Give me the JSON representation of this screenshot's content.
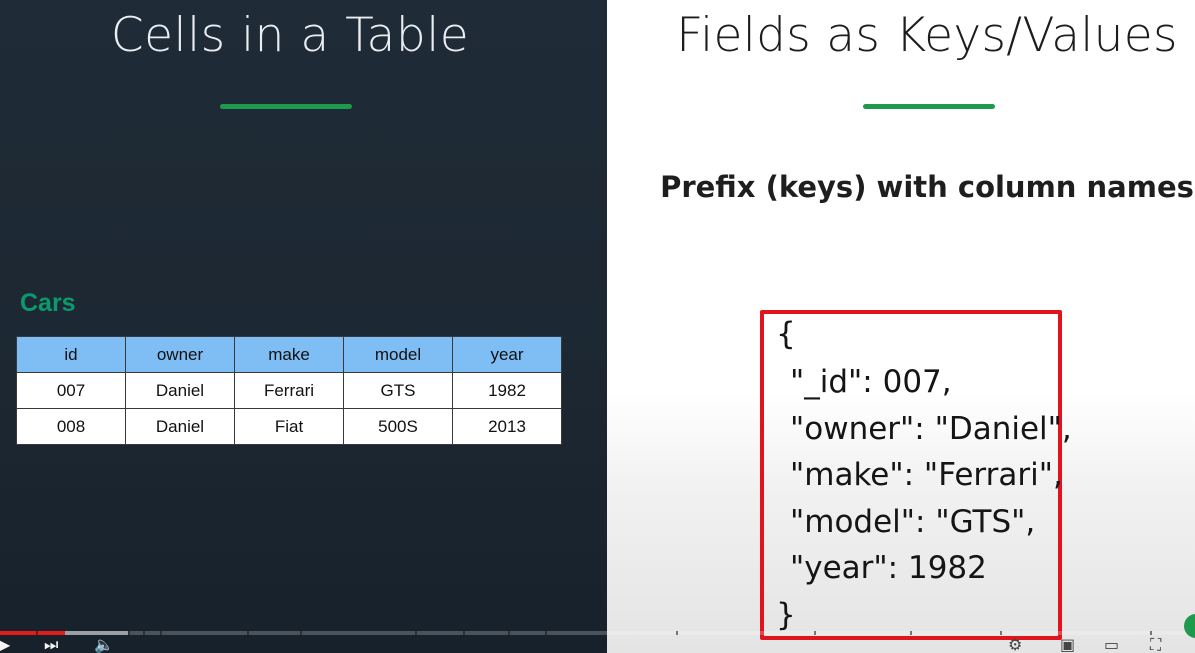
{
  "colors": {
    "accent_green": "#1e9a4c",
    "caption_green": "#0b9a6d",
    "table_header_bg": "#7fbdf5",
    "json_box_border": "#e0141c",
    "progress_played": "#e21b1b"
  },
  "left": {
    "title": "Cells in a Table",
    "table_caption": "Cars",
    "table": {
      "columns": [
        "id",
        "owner",
        "make",
        "model",
        "year"
      ],
      "rows": [
        [
          "007",
          "Daniel",
          "Ferrari",
          "GTS",
          "1982"
        ],
        [
          "008",
          "Daniel",
          "Fiat",
          "500S",
          "2013"
        ]
      ]
    }
  },
  "right": {
    "title": "Fields as Keys/Values",
    "subtitle": "Prefix (keys) with column names",
    "json_lines": [
      "{",
      "\"_id\": 007,",
      "\"owner\": \"Daniel\",",
      "\"make\": \"Ferrari\",",
      "\"model\": \"GTS\",",
      "\"year\": 1982",
      "}"
    ]
  },
  "player": {
    "progress_fraction": 0.054,
    "buffered_fraction": 0.107,
    "icons": [
      "play-icon",
      "next-icon",
      "volume-icon",
      "settings-icon",
      "miniplayer-icon",
      "theater-icon",
      "fullscreen-icon"
    ]
  }
}
